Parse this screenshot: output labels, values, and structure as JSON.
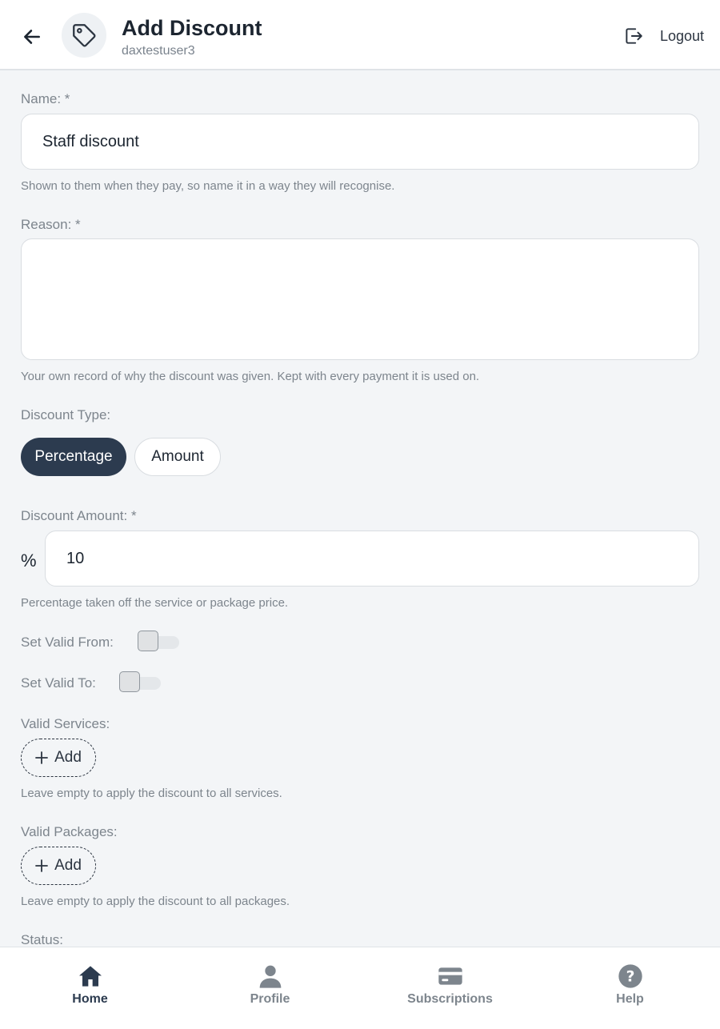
{
  "header": {
    "title": "Add Discount",
    "username": "daxtestuser3",
    "logout_label": "Logout"
  },
  "form": {
    "name": {
      "label": "Name: *",
      "value": "Staff discount",
      "help": "Shown to them when they pay, so name it in a way they will recognise."
    },
    "reason": {
      "label": "Reason: *",
      "value": "",
      "help": "Your own record of why the discount was given. Kept with every payment it is used on."
    },
    "discount_type": {
      "label": "Discount Type:",
      "options": [
        "Percentage",
        "Amount"
      ],
      "selected": "Percentage"
    },
    "discount_amount": {
      "label": "Discount Amount: *",
      "prefix": "%",
      "value": "10",
      "help": "Percentage taken off the service or package price."
    },
    "valid_from": {
      "label": "Set Valid From:",
      "enabled": false
    },
    "valid_to": {
      "label": "Set Valid To:",
      "enabled": false
    },
    "valid_services": {
      "label": "Valid Services:",
      "add_label": "Add",
      "help": "Leave empty to apply the discount to all services."
    },
    "valid_packages": {
      "label": "Valid Packages:",
      "add_label": "Add",
      "help": "Leave empty to apply the discount to all packages."
    },
    "status": {
      "label": "Status:"
    }
  },
  "bottom_nav": {
    "items": [
      {
        "label": "Home",
        "icon": "home-icon",
        "active": true
      },
      {
        "label": "Profile",
        "icon": "person-icon",
        "active": false
      },
      {
        "label": "Subscriptions",
        "icon": "card-icon",
        "active": false
      },
      {
        "label": "Help",
        "icon": "help-icon",
        "active": false
      }
    ]
  },
  "colors": {
    "accent": "#2c3b4f",
    "background": "#f3f5f7",
    "muted_text": "#7d858d"
  }
}
